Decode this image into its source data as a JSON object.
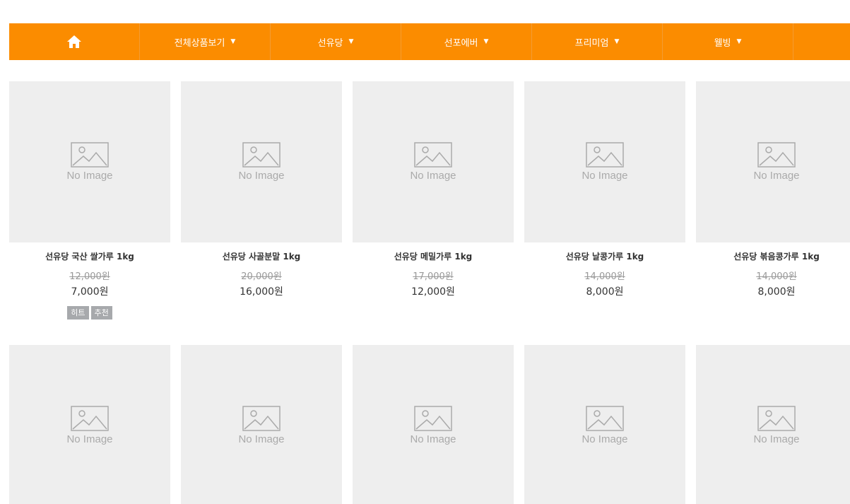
{
  "nav": {
    "home_icon": "home-icon",
    "items": [
      {
        "label": "전체상품보기",
        "caret": "▼"
      },
      {
        "label": "선유당",
        "caret": "▼"
      },
      {
        "label": "선포에버",
        "caret": "▼"
      },
      {
        "label": "프리미엄",
        "caret": "▼"
      },
      {
        "label": "웰빙",
        "caret": "▼"
      }
    ]
  },
  "placeholder": {
    "no_image_text": "No Image",
    "icon": "image-placeholder-icon"
  },
  "products": [
    {
      "name": "선유당 국산 쌀가루 1kg",
      "old_price": "12,000원",
      "price": "7,000원",
      "badges": [
        "히트",
        "추천"
      ]
    },
    {
      "name": "선유당 사골분말 1kg",
      "old_price": "20,000원",
      "price": "16,000원",
      "badges": []
    },
    {
      "name": "선유당 메밀가루 1kg",
      "old_price": "17,000원",
      "price": "12,000원",
      "badges": []
    },
    {
      "name": "선유당 날콩가루 1kg",
      "old_price": "14,000원",
      "price": "8,000원",
      "badges": []
    },
    {
      "name": "선유당 볶음콩가루 1kg",
      "old_price": "14,000원",
      "price": "8,000원",
      "badges": []
    }
  ],
  "second_row_count": 5,
  "colors": {
    "nav_bg": "#fb8c00",
    "thumb_bg": "#eeeeee",
    "badge_bg": "#a7a9ac"
  }
}
